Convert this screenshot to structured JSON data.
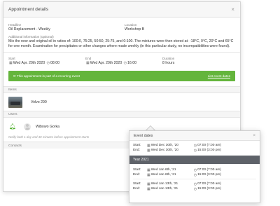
{
  "modal": {
    "title": "Appointment details",
    "close": "×"
  },
  "headline": {
    "label": "Headline",
    "value": "Oil Replacement - Weekly"
  },
  "location": {
    "label": "Location",
    "value": "Workshop B"
  },
  "info": {
    "label": "Additional information (optional)",
    "value": "Mix the new and original oil in ratios of: 100:0, 75:25, 50:50, 25:75, and 0:100. The mixtures were then stored at: -18°C, 0°C, 20°C and 65°C for one month. Examination for precipitates or other changes where made weekly (in this particular study, no incompatibilities were found)."
  },
  "start": {
    "label": "Start",
    "date": "Wed Apr. 29th 2020",
    "time": "08:00"
  },
  "end": {
    "label": "End",
    "date": "Wed Apr. 29th 2020",
    "time": "16:00"
  },
  "duration": {
    "label": "Duration",
    "value": "8 hours"
  },
  "recurring": {
    "text": "This appointment is part of a recurring event",
    "link": "List event dates",
    "color": "#64b53c"
  },
  "items": {
    "header": "Items",
    "list": [
      {
        "name": "Volvo 290",
        "icon": "vehicle-photo"
      }
    ]
  },
  "users": {
    "header": "Users",
    "list": [
      {
        "name": "Wibowo Gorka",
        "icon": "bell-icon"
      }
    ],
    "note": "Notify both 1 day and 30 minutes before appointment starts"
  },
  "contacts": {
    "header": "Contacts"
  },
  "event_dates": {
    "title": "Event dates",
    "close": "×",
    "start_label": "Start:",
    "end_label": "End:",
    "groups": [
      {
        "events": [
          {
            "start_date": "Wed Dec 30th, '20",
            "start_time": "07:00 (7:00 am)",
            "end_date": "Wed Dec 30th, '20",
            "end_time": "15:00 (3:00 pm)"
          }
        ]
      },
      {
        "year": "Year 2021",
        "events": [
          {
            "start_date": "Wed Jan 6th, '21",
            "start_time": "07:00 (7:00 am)",
            "end_date": "Wed Jan 6th, '21",
            "end_time": "15:00 (3:00 pm)"
          },
          {
            "start_date": "Wed Jan 13th, '21",
            "start_time": "07:00 (7:00 am)",
            "end_date": "Wed Jan 13th, '21",
            "end_time": "15:00 (3:00 pm)"
          }
        ]
      }
    ]
  }
}
